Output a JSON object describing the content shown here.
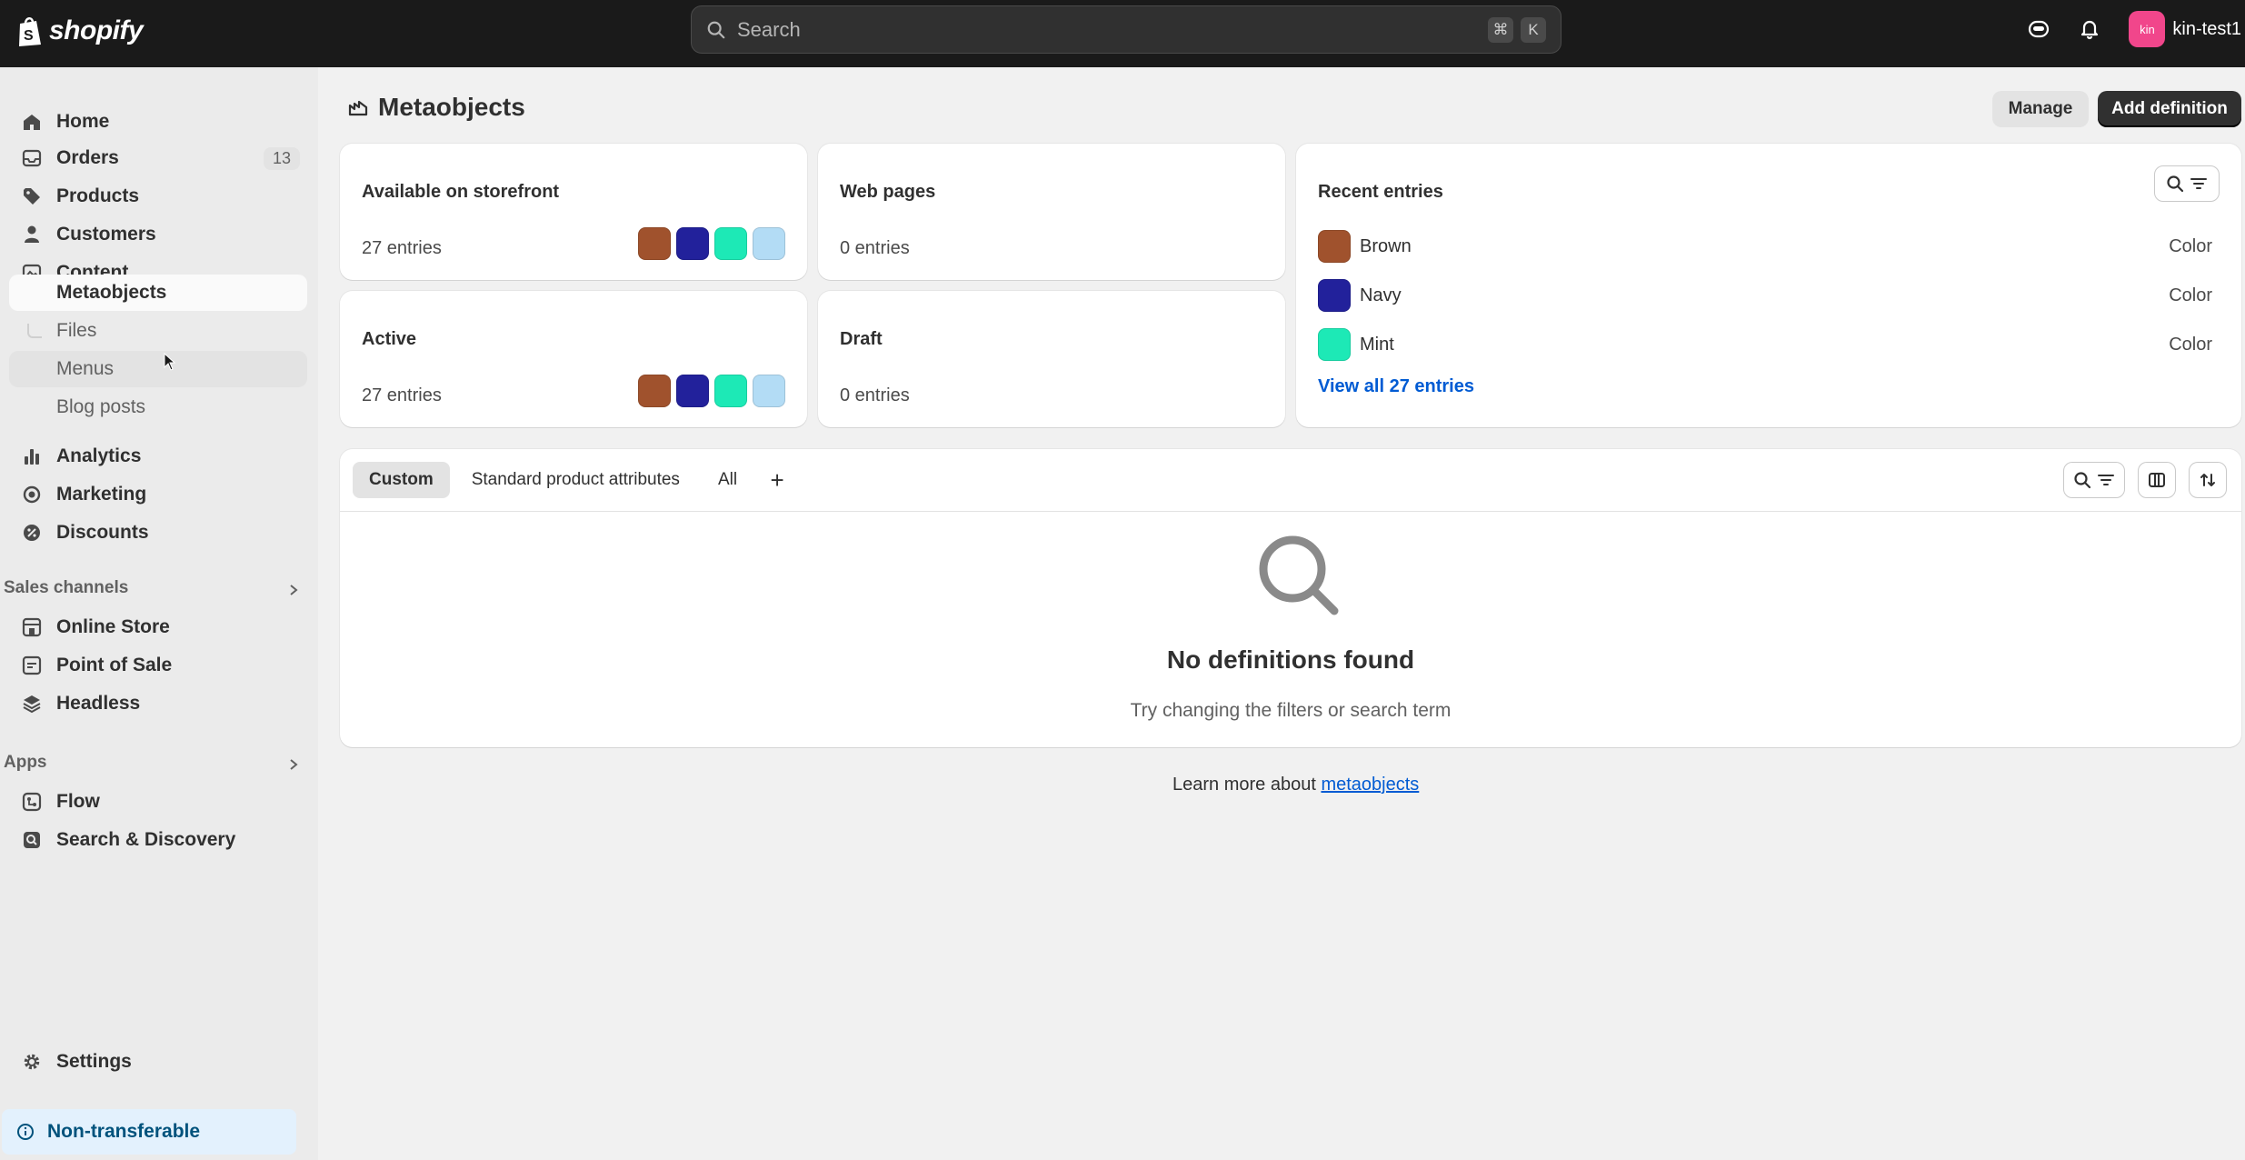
{
  "topbar": {
    "brand": "shopify",
    "search_placeholder": "Search",
    "shortcut_cmd": "⌘",
    "shortcut_key": "K",
    "avatar_initials": "kin",
    "store_name": "kin-test1"
  },
  "sidebar": {
    "home": "Home",
    "orders": "Orders",
    "orders_count": "13",
    "products": "Products",
    "customers": "Customers",
    "content": "Content",
    "metaobjects": "Metaobjects",
    "files": "Files",
    "menus": "Menus",
    "blog_posts": "Blog posts",
    "analytics": "Analytics",
    "marketing": "Marketing",
    "discounts": "Discounts",
    "sales_channels": "Sales channels",
    "online_store": "Online Store",
    "point_of_sale": "Point of Sale",
    "headless": "Headless",
    "apps": "Apps",
    "flow": "Flow",
    "search_discovery": "Search & Discovery",
    "settings": "Settings",
    "non_transferable": "Non-transferable"
  },
  "page": {
    "title": "Metaobjects",
    "manage_label": "Manage",
    "add_definition_label": "Add definition"
  },
  "summary": {
    "storefront": {
      "title": "Available on storefront",
      "count": "27 entries"
    },
    "web_pages": {
      "title": "Web pages",
      "count": "0 entries"
    },
    "active": {
      "title": "Active",
      "count": "27 entries"
    },
    "draft": {
      "title": "Draft",
      "count": "0 entries"
    }
  },
  "swatch_colors": [
    "#a0522d",
    "#22219b",
    "#1de9b6",
    "#b3dcf5"
  ],
  "recent": {
    "title": "Recent entries",
    "entries": [
      {
        "name": "Brown",
        "type": "Color",
        "color": "#a0522d"
      },
      {
        "name": "Navy",
        "type": "Color",
        "color": "#22219b"
      },
      {
        "name": "Mint",
        "type": "Color",
        "color": "#1de9b6"
      }
    ],
    "view_all": "View all 27 entries"
  },
  "definitions": {
    "tabs": [
      "Custom",
      "Standard product attributes",
      "All"
    ],
    "add_tab": "+",
    "empty_title": "No definitions found",
    "empty_subtitle": "Try changing the filters or search term"
  },
  "footer": {
    "learn_prefix": "Learn more about ",
    "learn_link": "metaobjects"
  }
}
